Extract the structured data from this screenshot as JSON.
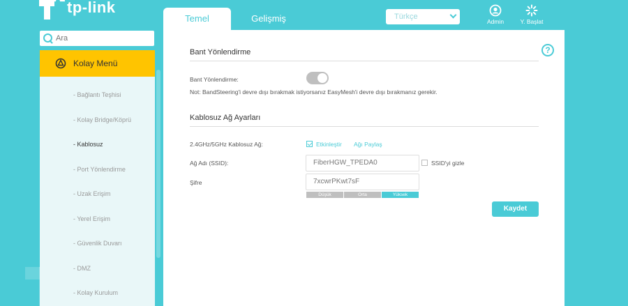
{
  "brand": {
    "name": "tp-link"
  },
  "tabs": [
    {
      "label": "Temel"
    },
    {
      "label": "Gelişmiş"
    }
  ],
  "language": {
    "selected": "Türkçe"
  },
  "top_actions": {
    "admin": "Admin",
    "reboot": "Y. Başlat"
  },
  "search": {
    "placeholder": "Ara"
  },
  "sidebar": {
    "header": "Kolay Menü",
    "items": [
      {
        "label": "- Bağlantı Teşhisi"
      },
      {
        "label": "- Kolay Bridge/Köprü"
      },
      {
        "label": "- Kablosuz"
      },
      {
        "label": "- Port Yönlendirme"
      },
      {
        "label": "- Uzak Erişim"
      },
      {
        "label": "- Yerel Erişim"
      },
      {
        "label": "- Güvenlik Duvarı"
      },
      {
        "label": "- DMZ"
      },
      {
        "label": "- Kolay Kurulum"
      }
    ],
    "active_index": 2
  },
  "band_steering": {
    "title": "Bant Yönlendirme",
    "label": "Bant Yönlendirme:",
    "enabled": true,
    "note": "Not: BandSteering'i devre dışı bırakmak istiyorsanız EasyMesh'i devre dışı bırakmanız gerekir."
  },
  "wireless": {
    "title": "Kablosuz Ağ Ayarları",
    "band_label": "2.4GHz/5GHz Kablosuz Ağ:",
    "enable_label": "Etkinleştir",
    "share_label": "Ağı Paylaş",
    "ssid_label": "Ağ Adı (SSID):",
    "ssid_value": "FiberHGW_TPEDA0",
    "hide_ssid_label": "SSID'yi gizle",
    "password_label": "Şifre",
    "password_value": "7xcwrPKwt7sF",
    "strength": {
      "low": "Düşük",
      "mid": "Orta",
      "high": "Yüksek"
    }
  },
  "save_label": "Kaydet",
  "colors": {
    "accent": "#4acbd6",
    "menu_header": "#ffc400"
  }
}
